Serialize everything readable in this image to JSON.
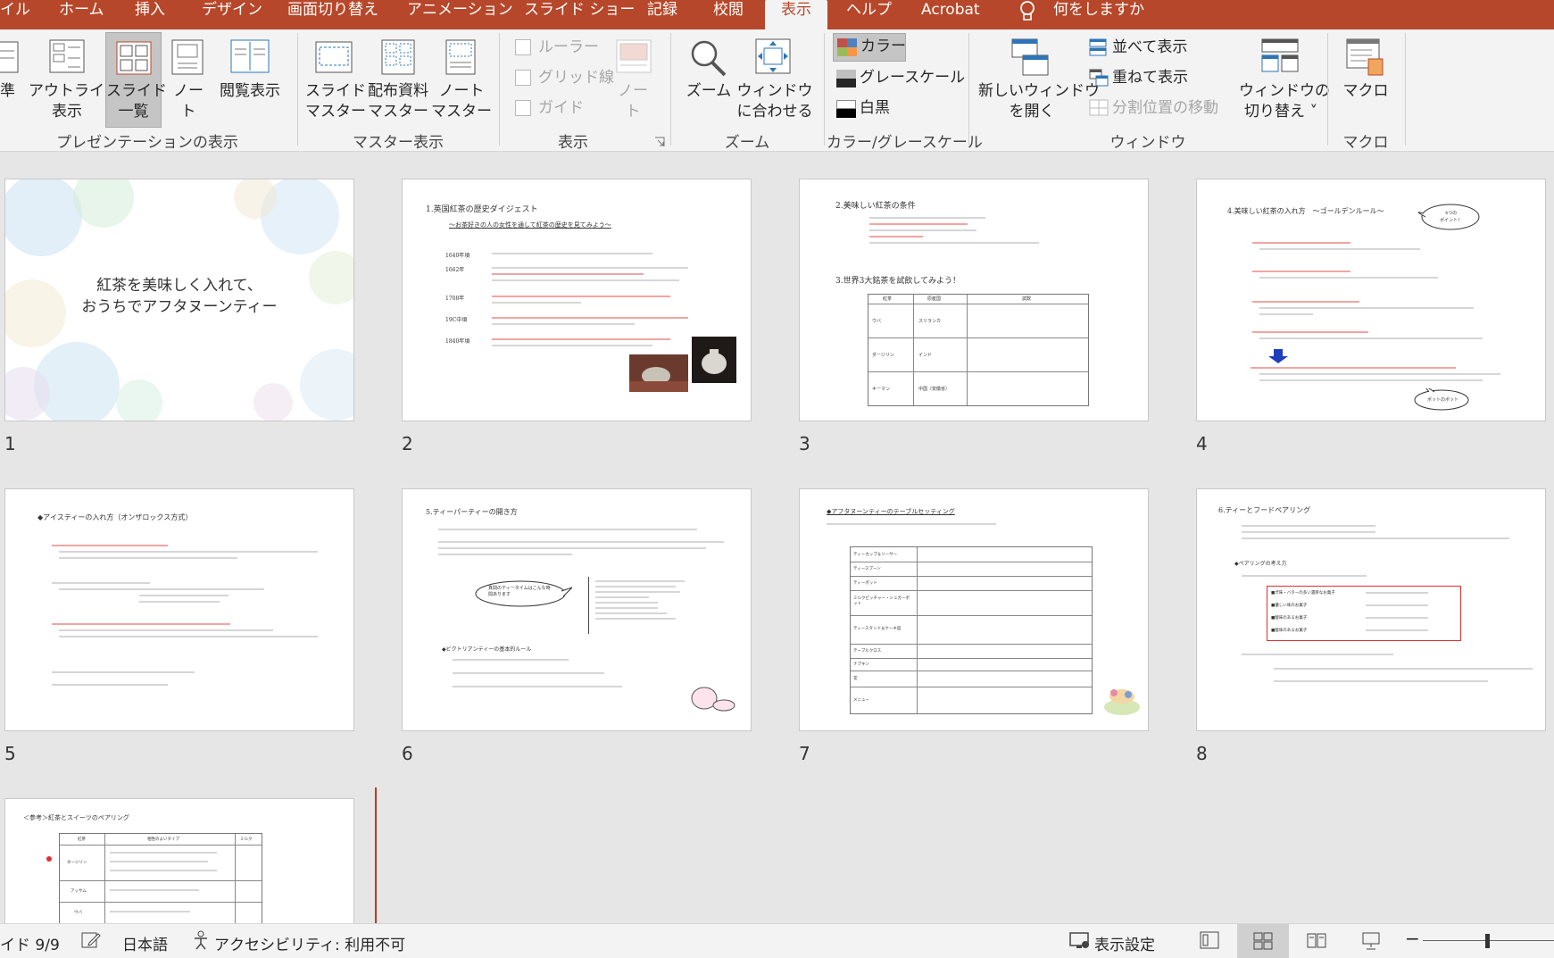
{
  "tabs": {
    "file_partial": "イル",
    "home": "ホーム",
    "insert": "挿入",
    "design": "デザイン",
    "transitions": "画面切り替え",
    "animations": "アニメーション",
    "slideshow": "スライド ショー",
    "record": "記録",
    "review": "校閲",
    "view": "表示",
    "help": "ヘルプ",
    "acrobat": "Acrobat",
    "tell_me": "何をしますか"
  },
  "ribbon": {
    "normal_partial": "準",
    "outline_1": "アウトライン",
    "outline_2": "表示",
    "sorter_1": "スライド",
    "sorter_2": "一覧",
    "notes_1": "ノー",
    "notes_2": "ト",
    "reading": "閲覧表示",
    "group_presentation_views": "プレゼンテーションの表示",
    "slide_master_1": "スライド",
    "slide_master_2": "マスター",
    "handout_master_1": "配布資料",
    "handout_master_2": "マスター",
    "notes_master_1": "ノート",
    "notes_master_2": "マスター",
    "group_master_views": "マスター表示",
    "ruler": "ルーラー",
    "gridlines": "グリッド線",
    "guides": "ガイド",
    "notes_disabled_1": "ノー",
    "notes_disabled_2": "ト",
    "group_show": "表示",
    "zoom": "ズーム",
    "fit_1": "ウィンドウ",
    "fit_2": "に合わせる",
    "group_zoom": "ズーム",
    "color": "カラー",
    "grayscale": "グレースケール",
    "bw": "白黒",
    "group_color": "カラー/グレースケール",
    "new_window_1": "新しいウィンドウ",
    "new_window_2": "を開く",
    "arrange_all": "並べて表示",
    "cascade": "重ねて表示",
    "move_split": "分割位置の移動",
    "switch_1": "ウィンドウの",
    "switch_2": "切り替え ˅",
    "group_window": "ウィンドウ",
    "macros": "マクロ",
    "group_macros": "マクロ"
  },
  "slides": [
    {
      "num": "1",
      "line1": "紅茶を美味しく入れて、",
      "line2": "おうちでアフタヌーンティー"
    },
    {
      "num": "2",
      "title": "1.英国紅茶の歴史ダイジェスト",
      "subtitle": "〜お茶好きの人の女性を通して紅茶の歴史を見てみよう〜",
      "rows": [
        "1640年頃",
        "1662年",
        "1708年",
        "19C中頃",
        "1840年頃"
      ]
    },
    {
      "num": "3",
      "title": "2.美味しい紅茶の条件",
      "title2": "3.世界3大銘茶を試飲してみよう！",
      "cols": [
        "紅茶",
        "原産国",
        "試飲"
      ],
      "rows": [
        "ウバ",
        "ダージリン",
        "キーマン"
      ],
      "origins": [
        "スリランカ",
        "インド",
        "中国（安徽省）"
      ]
    },
    {
      "num": "4",
      "title": "4.美味しい紅茶の入れ方　〜ゴールデンルール〜",
      "bubble1": "4つの",
      "bubble2": "ポイント！",
      "bubble3": "ポットのポット"
    },
    {
      "num": "5",
      "title": "◆アイスティーの入れ方（オンザロックス方式）"
    },
    {
      "num": "6",
      "title": "5.ティーパーティーの開き方",
      "section": "◆ビクトリアンティーの基本的ルール",
      "bubble": "真間のティータイムはこんな時間あります"
    },
    {
      "num": "7",
      "title": "◆アフタヌーンティーのテーブルセッティング",
      "rows": [
        "ティーカップ＆ソーサー",
        "ティースプーン",
        "ティーポット",
        "ミルクピッチャー・シュガーポット",
        "ティースタンド＆ケーキ皿",
        "テーブルクロス",
        "ナプキン",
        "花",
        "メニュー"
      ]
    },
    {
      "num": "8",
      "title": "6.ティーとフードペアリング",
      "section": "◆ペアリングの考え方",
      "pairs": [
        "■渋味・バターの多い濃厚なお菓子",
        "■優しい味のお菓子",
        "■酸味のあるお菓子",
        "■酸味のあるお菓子"
      ]
    },
    {
      "num": "9",
      "title": "＜参考＞紅茶とスイーツのペアリング",
      "cols": [
        "紅茶",
        "相性のよいタイプ",
        "ミルク"
      ],
      "rows": [
        "ダージリン",
        "アッサム",
        "ウバ"
      ]
    }
  ],
  "status": {
    "slide_count": "イド 9/9",
    "language": "日本語",
    "accessibility": "アクセシビリティ: 利用不可",
    "display_settings": "表示設定"
  },
  "colors": {
    "accent": "#b7472a"
  }
}
